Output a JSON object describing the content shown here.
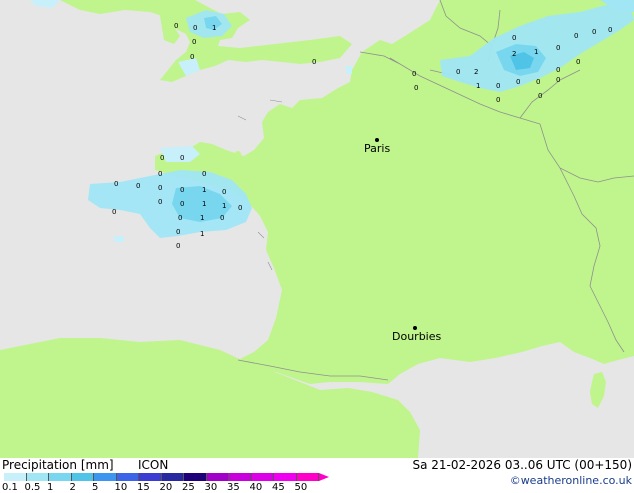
{
  "map": {
    "cities": [
      {
        "name": "Paris"
      },
      {
        "name": "Dourbies"
      }
    ],
    "values": [
      "0",
      "0",
      "1",
      "0",
      "0",
      "0",
      "2",
      "1",
      "0",
      "0",
      "0",
      "0",
      "0",
      "2",
      "1",
      "0",
      "0",
      "0",
      "0",
      "0",
      "0",
      "0",
      "0",
      "0",
      "0",
      "0",
      "0",
      "0",
      "0",
      "0",
      "0",
      "0",
      "1",
      "0",
      "0",
      "1",
      "1",
      "0",
      "0",
      "1",
      "0",
      "0",
      "1",
      "0",
      "0",
      "0",
      "0",
      "0"
    ]
  },
  "footer": {
    "title": "Precipitation [mm]",
    "model": "ICON",
    "datetime": "Sa 21-02-2026 03..06 UTC (00+150)",
    "credit": "©weatheronline.co.uk",
    "scale_labels": [
      "0.1",
      "0.5",
      "1",
      "2",
      "5",
      "10",
      "15",
      "20",
      "25",
      "30",
      "35",
      "40",
      "45",
      "50"
    ],
    "scale_colors": [
      "#c8f0fa",
      "#a0e6f5",
      "#78d7ef",
      "#50c4e6",
      "#3c96f0",
      "#3c64e6",
      "#3c3cd2",
      "#2828a0",
      "#1e0078",
      "#a000c8",
      "#c800dc",
      "#dc00e6",
      "#f000f0",
      "#ff00c8"
    ]
  }
}
